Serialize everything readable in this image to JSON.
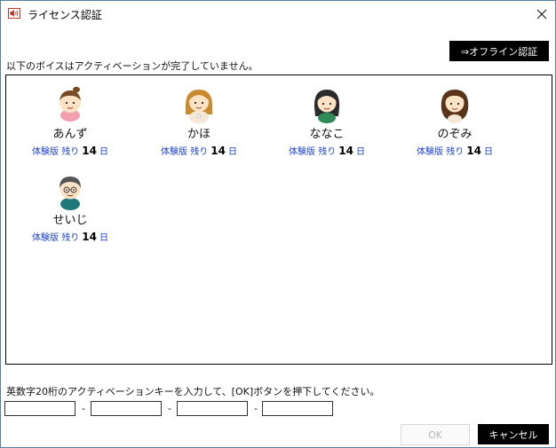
{
  "window": {
    "title": "ライセンス認証",
    "app_icon": "speaker-icon",
    "close_icon": "close-icon"
  },
  "toolbar": {
    "offline_label": "⇒オフライン認証"
  },
  "status": {
    "message": "以下のボイスはアクティベーションが完了していません。"
  },
  "voices": [
    {
      "name": "あんず",
      "trial_prefix": "体験版 残り",
      "days": "14",
      "unit": "日"
    },
    {
      "name": "かほ",
      "trial_prefix": "体験版 残り",
      "days": "14",
      "unit": "日"
    },
    {
      "name": "ななこ",
      "trial_prefix": "体験版 残り",
      "days": "14",
      "unit": "日"
    },
    {
      "name": "のぞみ",
      "trial_prefix": "体験版 残り",
      "days": "14",
      "unit": "日"
    },
    {
      "name": "せいじ",
      "trial_prefix": "体験版 残り",
      "days": "14",
      "unit": "日"
    }
  ],
  "activation": {
    "instruction": "英数字20桁のアクティベーションキーを入力して、[OK]ボタンを押下してください。",
    "key_fields": [
      "",
      "",
      "",
      ""
    ],
    "separator": "-"
  },
  "buttons": {
    "ok_label": "OK",
    "cancel_label": "キャンセル"
  },
  "colors": {
    "accent_black": "#000000",
    "trial_text": "#1a3fd0",
    "window_border": "#5a7fa6",
    "disabled_text": "#b5b5b5"
  }
}
